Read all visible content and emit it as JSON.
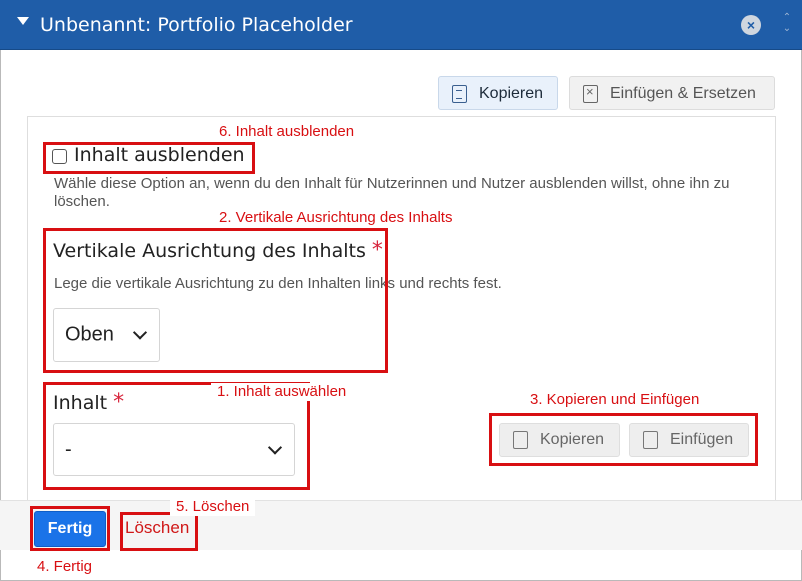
{
  "window": {
    "title": "Unbenannt: Portfolio Placeholder"
  },
  "toolbar": {
    "copy_label": "Kopieren",
    "paste_replace_label": "Einfügen & Ersetzen"
  },
  "hide_content": {
    "label": "Inhalt ausblenden",
    "checked": false,
    "help": "Wähle diese Option an, wenn du den Inhalt für Nutzerinnen und Nutzer ausblenden willst, ohne ihn zu löschen."
  },
  "vertical_alignment": {
    "label": "Vertikale Ausrichtung des Inhalts",
    "required_mark": "*",
    "help": "Lege die vertikale Ausrichtung zu den Inhalten links und rechts fest.",
    "selected": "Oben"
  },
  "content": {
    "label": "Inhalt",
    "required_mark": "*",
    "selected": "-",
    "copy_label": "Kopieren",
    "paste_label": "Einfügen"
  },
  "footer": {
    "done_label": "Fertig",
    "delete_label": "Löschen"
  },
  "annotations": {
    "n1": "1. Inhalt auswählen",
    "n2": "2. Vertikale Ausrichtung des Inhalts",
    "n3": "3. Kopieren und Einfügen",
    "n4": "4. Fertig",
    "n5": "5. Löschen",
    "n6": "6. Inhalt ausblenden",
    "color": "#d80f12"
  },
  "colors": {
    "titlebar": "#1f5da8",
    "primary_button": "#1a73e8",
    "delete_text": "#d01818",
    "required": "#d7263d"
  }
}
